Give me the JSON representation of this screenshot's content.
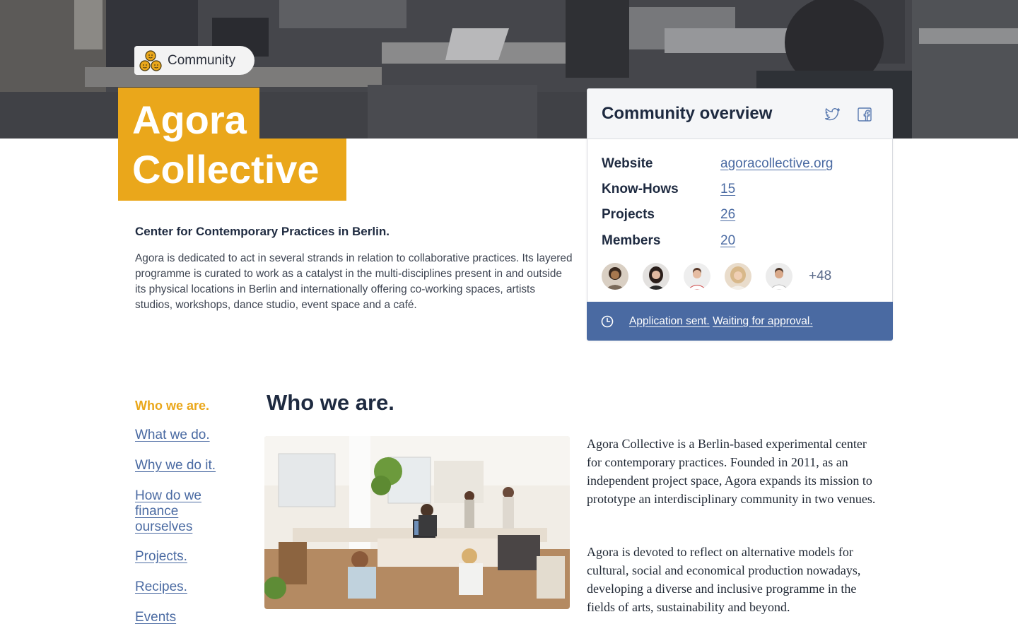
{
  "hero": {
    "chip_label": "Community",
    "chip_icon": "community-icon",
    "title_line1": "Agora",
    "title_line2": "Collective"
  },
  "intro": {
    "subtitle": "Center for Contemporary Practices in Berlin.",
    "description": "Agora is dedicated to act in several strands in relation to collaborative practices. Its layered programme is curated to work as a catalyst in the multi-disciplines present in and outside its physical locations in Berlin and internationally offering co-working spaces, artists studios, workshops, dance studio, event space and a café."
  },
  "overview": {
    "title": "Community overview",
    "social_icons": [
      "twitter-icon",
      "facebook-icon"
    ],
    "rows": [
      {
        "label": "Website",
        "value": "agoracollective.org"
      },
      {
        "label": "Know-Hows",
        "value": "15"
      },
      {
        "label": "Projects",
        "value": "26"
      },
      {
        "label": "Members",
        "value": "20"
      }
    ],
    "more_members": "+48",
    "status_icon": "clock-icon",
    "status_part1": "Application sent.",
    "status_part2": "Waiting for approval."
  },
  "nav": {
    "items": [
      "Who we are.",
      "What we do.",
      "Why we do it.",
      "How do we finance ourselves",
      "Projects.",
      "Recipes.",
      "Events"
    ],
    "active_index": 0
  },
  "section": {
    "title": "Who we are.",
    "paragraph1": "Agora Collective is a Berlin-based experimental center for contemporary practices. Founded in 2011, as an independent project space, Agora expands its mission to prototype an interdisciplinary community in two venues.",
    "paragraph2": "Agora is devoted to reflect on alternative models for cultural, social and economical production nowadays, developing a diverse and inclusive programme in the fields of arts, sustainability and beyond."
  },
  "colors": {
    "accent": "#eaa71b",
    "link": "#4a6aa2",
    "text": "#1e2a40"
  }
}
